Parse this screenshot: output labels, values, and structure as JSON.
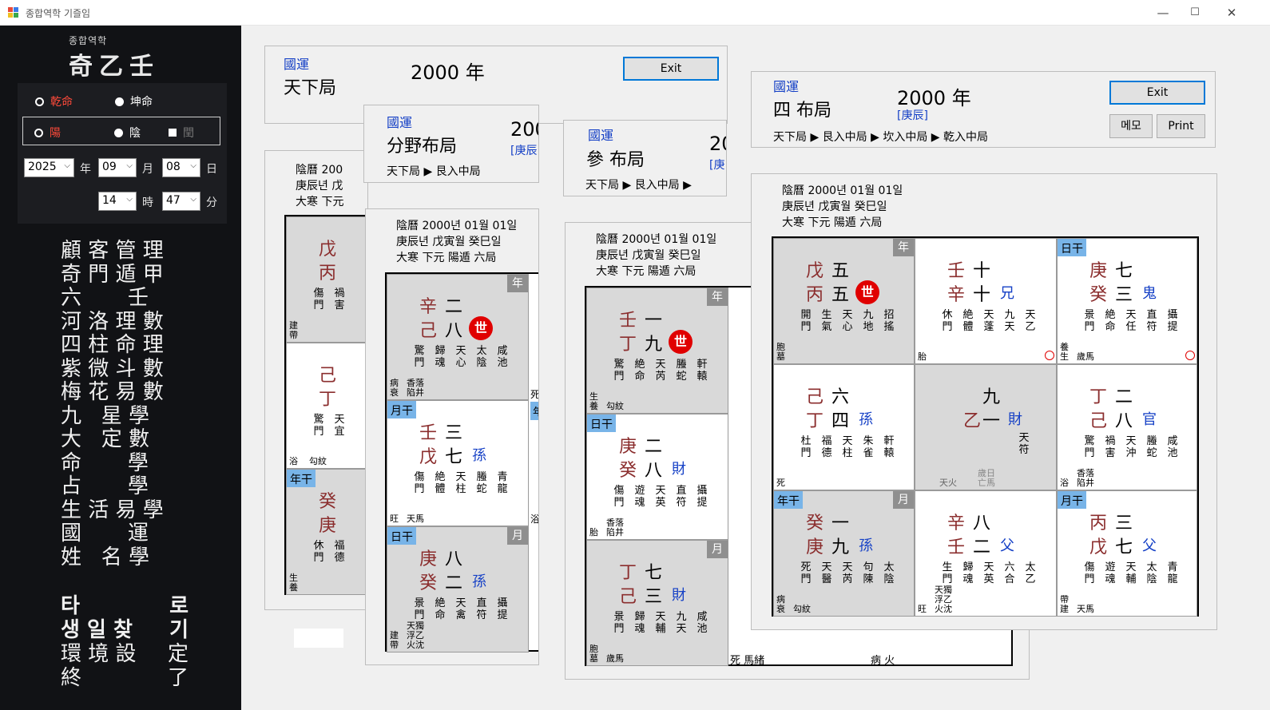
{
  "window": {
    "title": "종합역학 기즐임",
    "min": "—",
    "max": "☐",
    "close": "✕"
  },
  "sidebar": {
    "logo_small": "종합역학",
    "logo_big": "奇乙壬",
    "qian": "乾命",
    "kun": "坤命",
    "yang": "陽",
    "yin": "陰",
    "run": "閏",
    "year": "2025",
    "month": "09",
    "day": "08",
    "hour": "14",
    "minute": "47",
    "year_lbl": "年",
    "month_lbl": "月",
    "day_lbl": "日",
    "hour_lbl": "時",
    "min_lbl": "分",
    "menu1": [
      "顧 客 管 理",
      "奇 門 遁 甲",
      "六       壬",
      "河 洛 理 數",
      "四 柱 命 理",
      "紫 微 斗 數",
      "梅 花 易 數",
      "九   星 學",
      "大   定 數",
      "命       學",
      "占       學",
      "生 活 易 學",
      "國       運",
      "姓   名 學"
    ],
    "menu2_left": [
      "타",
      "생 일 찾",
      "環 境 設",
      "終"
    ],
    "menu2_right": [
      "로",
      "기",
      "定",
      "了"
    ]
  },
  "card1": {
    "guk": "國運",
    "name": "天下局",
    "year": "2000 年",
    "exit": "Exit",
    "info": [
      "陰曆 200",
      "庚辰년 戊",
      "大寒 下元"
    ],
    "cells": [
      {
        "stem1": "戊",
        "stem2": "丙",
        "tags": [
          "傷門",
          "禍害"
        ],
        "bl": "建帶"
      },
      {
        "stem1": "己",
        "stem2": "丁",
        "tags": [
          "驚門",
          "天宜"
        ],
        "bl": "浴",
        "bm": "勾紋"
      },
      {
        "stem1": "癸",
        "stem2": "庚",
        "tags": [
          "休門",
          "福德"
        ],
        "bl": "生養",
        "badge": "年干"
      }
    ]
  },
  "card2": {
    "guk": "國運",
    "name": "分野布局",
    "year": "200",
    "ganji": "[庚辰",
    "path": "天下局  ▶ 艮入中局",
    "info": [
      "陰曆 2000년 01월 01일",
      "庚辰년 戊寅월 癸巳일",
      "大寒 下元 陽遁 六局"
    ],
    "cells": [
      {
        "s1": "辛",
        "n1": "二",
        "s2": "己",
        "n2": "八",
        "se": "世",
        "tags": [
          "驚門",
          "歸魂",
          "天心",
          "太陰",
          "咸池"
        ],
        "bl": "病衰",
        "bm": "香落陷井",
        "corner": "年",
        "g": true
      },
      {
        "s1": "壬",
        "n1": "三",
        "s2": "戊",
        "n2": "七",
        "rel": "孫",
        "tags": [
          "傷門",
          "絶體",
          "天柱",
          "螣蛇",
          "青龍"
        ],
        "bl": "旺",
        "bm": "天馬",
        "badge": "月干"
      },
      {
        "s1": "庚",
        "n1": "八",
        "s2": "癸",
        "n2": "二",
        "rel": "孫",
        "tags": [
          "景門",
          "絶命",
          "天禽",
          "直符",
          "攝提"
        ],
        "bl": "建帶",
        "bm": "天獨浮乙火沈",
        "corner": "月",
        "badge": "日干",
        "g": true
      }
    ],
    "side": [
      "死",
      "年",
      "浴"
    ]
  },
  "card3": {
    "guk": "國運",
    "name": "參 布局",
    "year": "20",
    "ganji": "[庚",
    "path": "天下局  ▶ 艮入中局  ▶",
    "info": [
      "陰曆 2000년 01월 01일",
      "庚辰년 戊寅월 癸巳일",
      "大寒 下元 陽遁 六局"
    ],
    "cells": [
      {
        "s1": "壬",
        "n1": "一",
        "s2": "丁",
        "n2": "九",
        "se": "世",
        "tags": [
          "驚門",
          "絶命",
          "天芮",
          "螣蛇",
          "軒轅"
        ],
        "bl": "生養",
        "bm": "勾紋",
        "corner": "年",
        "g": true
      },
      {
        "s1": "庚",
        "n1": "二",
        "s2": "癸",
        "n2": "八",
        "rel": "財",
        "tags": [
          "傷門",
          "遊魂",
          "天英",
          "直符",
          "攝提"
        ],
        "bl": "胎",
        "bm": "香落陷井",
        "badge": "日干"
      },
      {
        "s1": "丁",
        "n1": "七",
        "s2": "己",
        "n2": "三",
        "rel": "財",
        "tags": [
          "景門",
          "歸魂",
          "天輔",
          "九天",
          "咸池"
        ],
        "bl": "胞墓",
        "bm": "歲馬",
        "corner": "月",
        "g": true
      }
    ],
    "strip": [
      "死   馬緒",
      "病   火"
    ]
  },
  "card4": {
    "guk": "國運",
    "name": "四 布局",
    "year": "2000 年",
    "ganji": "[庚辰]",
    "exit": "Exit",
    "memo": "메모",
    "print": "Print",
    "path": "天下局  ▶ 艮入中局  ▶ 坎入中局 ▶ 乾入中局",
    "info": [
      "陰曆 2000년 01월 01일",
      "庚辰년 戊寅월 癸巳일",
      "大寒 下元 陽遁 六局"
    ],
    "cells": [
      {
        "s1": "戊",
        "n1": "五",
        "s2": "丙",
        "n2": "五",
        "se": "世",
        "tags": [
          "開門",
          "生氣",
          "天心",
          "九地",
          "招搖"
        ],
        "bl": "胞墓",
        "corner": "年",
        "g": true
      },
      {
        "s1": "壬",
        "n1": "十",
        "s2": "辛",
        "n2": "十",
        "rel": "兄",
        "tags": [
          "休門",
          "絶體",
          "天蓬",
          "九天",
          "天乙"
        ],
        "bl": "胎",
        "circ": true
      },
      {
        "s1": "庚",
        "n1": "七",
        "s2": "癸",
        "n2": "三",
        "rel": "鬼",
        "tags": [
          "景門",
          "絶命",
          "天任",
          "直符",
          "攝提"
        ],
        "bl": "養生",
        "bm": "歲馬",
        "badge": "日干",
        "circ": true
      },
      {
        "s1": "己",
        "n1": "六",
        "s2": "丁",
        "n2": "四",
        "rel": "孫",
        "tags": [
          "杜門",
          "福德",
          "天柱",
          "朱雀",
          "軒轅"
        ],
        "bl": "死"
      },
      {
        "s1": "",
        "n1": "九",
        "s2": "乙",
        "n2": "一",
        "rel": "財",
        "tags": [
          "天符"
        ],
        "bl": "",
        "bm": "天火",
        "bm2": "歲日亡馬",
        "g": true,
        "center": true
      },
      {
        "s1": "丁",
        "n1": "二",
        "s2": "己",
        "n2": "八",
        "rel": "官",
        "tags": [
          "驚門",
          "禍害",
          "天沖",
          "螣蛇",
          "咸池"
        ],
        "bl": "浴",
        "bm": "香落陷井"
      },
      {
        "s1": "癸",
        "n1": "一",
        "s2": "庚",
        "n2": "九",
        "rel": "孫",
        "tags": [
          "死門",
          "天醫",
          "天芮",
          "句陳",
          "太陰"
        ],
        "bl": "病衰",
        "bm": "勾紋",
        "corner": "月",
        "badge": "年干",
        "g": true
      },
      {
        "s1": "辛",
        "n1": "八",
        "s2": "壬",
        "n2": "二",
        "rel": "父",
        "tags": [
          "生門",
          "歸魂",
          "天英",
          "六合",
          "太乙"
        ],
        "bl": "旺",
        "bm": "天獨浮乙火沈"
      },
      {
        "s1": "丙",
        "n1": "三",
        "s2": "戊",
        "n2": "七",
        "rel": "父",
        "tags": [
          "傷門",
          "遊魂",
          "天輔",
          "太陰",
          "青龍"
        ],
        "bl": "帶建",
        "bm": "天馬",
        "badge": "月干"
      }
    ]
  }
}
